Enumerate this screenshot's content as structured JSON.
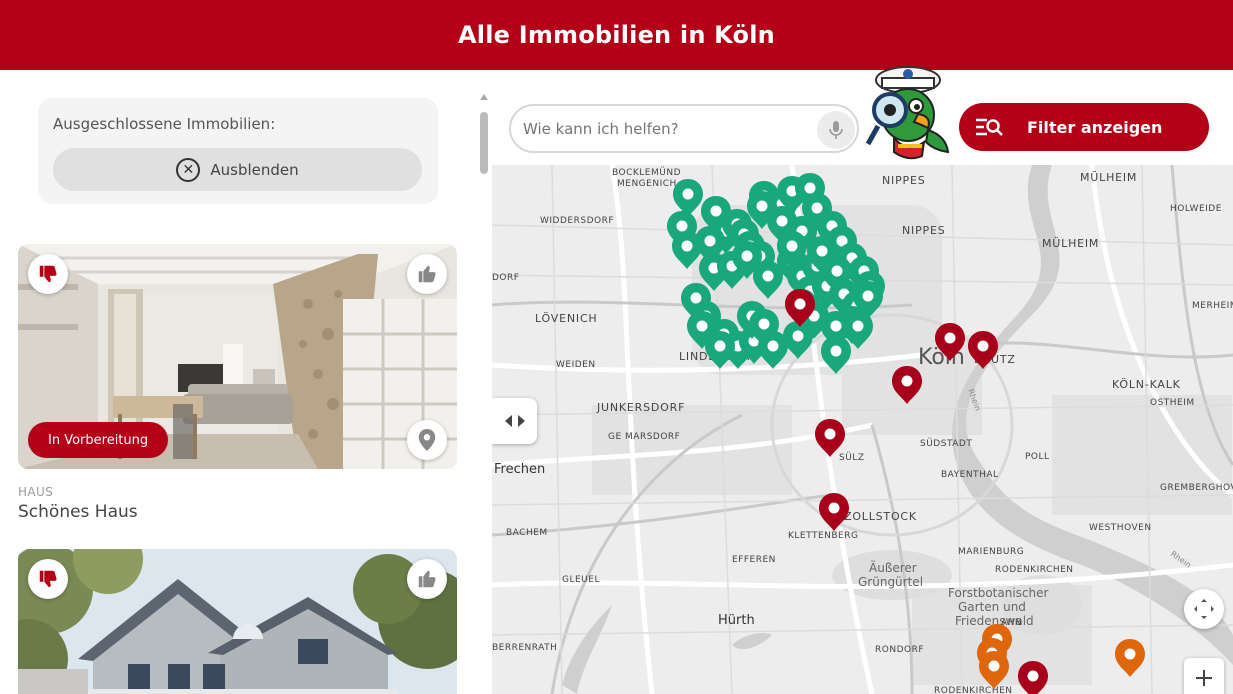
{
  "header": {
    "title": "Alle Immobilien in Köln"
  },
  "excluded": {
    "label": "Ausgeschlossene Immobilien:",
    "button_label": "Ausblenden"
  },
  "listings": [
    {
      "status_badge": "In Vorbereitung",
      "type": "HAUS",
      "title": "Schönes Haus"
    },
    {
      "status_badge": "",
      "type": "",
      "title": ""
    }
  ],
  "search": {
    "placeholder": "Wie kann ich helfen?"
  },
  "filter": {
    "label": "Filter anzeigen"
  },
  "map": {
    "labels": {
      "bocklemuend": "BOCKLEMÜND\nMENGENICH",
      "nippes1": "NIPPES",
      "nippes2": "NIPPES",
      "muelheim1": "MÜLHEIM",
      "muelheim2": "MÜLHEIM",
      "holweide": "HOLWEIDE",
      "widdersdorf": "WIDDERSDORF",
      "merheim": "MERHEIM",
      "dorf": "DORF",
      "loevenich": "LÖVENICH",
      "lindenthal": "LINDENTHAL",
      "weiden": "WEIDEN",
      "koeln": "Köln",
      "deutz": "DEUTZ",
      "koelnkalk": "KÖLN-KALK",
      "ostheim": "OSTHEIM",
      "junkersdorf": "JUNKERSDORF",
      "gemarsdorf": "GE MARSDORF",
      "suedstadt": "SÜDSTADT",
      "suelz": "SÜLZ",
      "frechen": "Frechen",
      "poll": "POLL",
      "bayenthal": "BAYENTHAL",
      "gremberghoven": "GREMBERGHOVE",
      "zollstock": "ZOLLSTOCK",
      "bachem": "BACHEM",
      "klettenberg": "KLETTENBERG",
      "westhoven": "WESTHOVEN",
      "marienburg": "MARIENBURG",
      "efferen": "EFFEREN",
      "aeussererGruenguertel": "Äußerer\nGrüngürtel",
      "rodenkirchen1": "RODENKIRCHEN",
      "gleuel": "GLEUEL",
      "forstbot": "Forstbotanischer\nGarten und\nFriedenswald",
      "huerth": "Hürth",
      "berrenrath": "BERRENRATH",
      "rondorf": "RONDORF",
      "rodenkirchen2": "RODENKIRCHEN",
      "ahn": "AHN",
      "rhein": "Rhein"
    }
  },
  "colors": {
    "brand": "#b40017",
    "marker_green": "#19a87b",
    "marker_red": "#a8001a",
    "marker_orange": "#e0660c"
  },
  "icons": {
    "dislike": "thumbs-down-icon",
    "like": "thumbs-up-icon",
    "location": "location-pin-icon",
    "close": "close-circle-icon",
    "mic": "microphone-icon",
    "filter": "filter-search-icon",
    "expand": "expand-icon",
    "zoom_in": "plus-icon",
    "split": "split-arrows-icon",
    "mascot": "parrot-mascot-icon"
  }
}
